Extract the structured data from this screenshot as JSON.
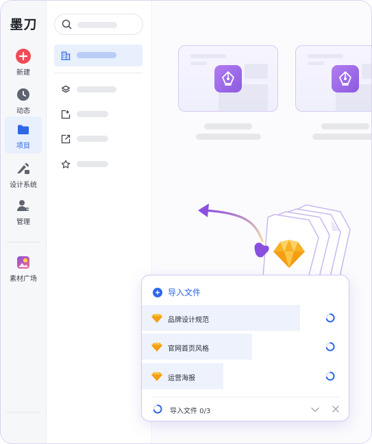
{
  "app": {
    "logo": "墨刀"
  },
  "rail": {
    "items": [
      {
        "label": "新建",
        "icon": "plus-circle-icon"
      },
      {
        "label": "动态",
        "icon": "clock-icon"
      },
      {
        "label": "项目",
        "icon": "folder-icon",
        "active": true
      },
      {
        "label": "设计系统",
        "icon": "design-system-icon"
      },
      {
        "label": "管理",
        "icon": "user-manage-icon"
      },
      {
        "label": "素材广场",
        "icon": "assets-icon"
      }
    ]
  },
  "colors": {
    "accent": "#2f66e8",
    "new_button": "#ef4b57",
    "sketch_orange": "#f5a623",
    "purple_arrow": "#8b4fe0"
  },
  "import_panel": {
    "header_label": "导入文件",
    "files": [
      {
        "name": "品牌设计规范",
        "progress": 0.76
      },
      {
        "name": "官网首页风格",
        "progress": 0.53
      },
      {
        "name": "运营海报",
        "progress": 0.39
      }
    ],
    "footer_status": "导入文件 0/3"
  }
}
